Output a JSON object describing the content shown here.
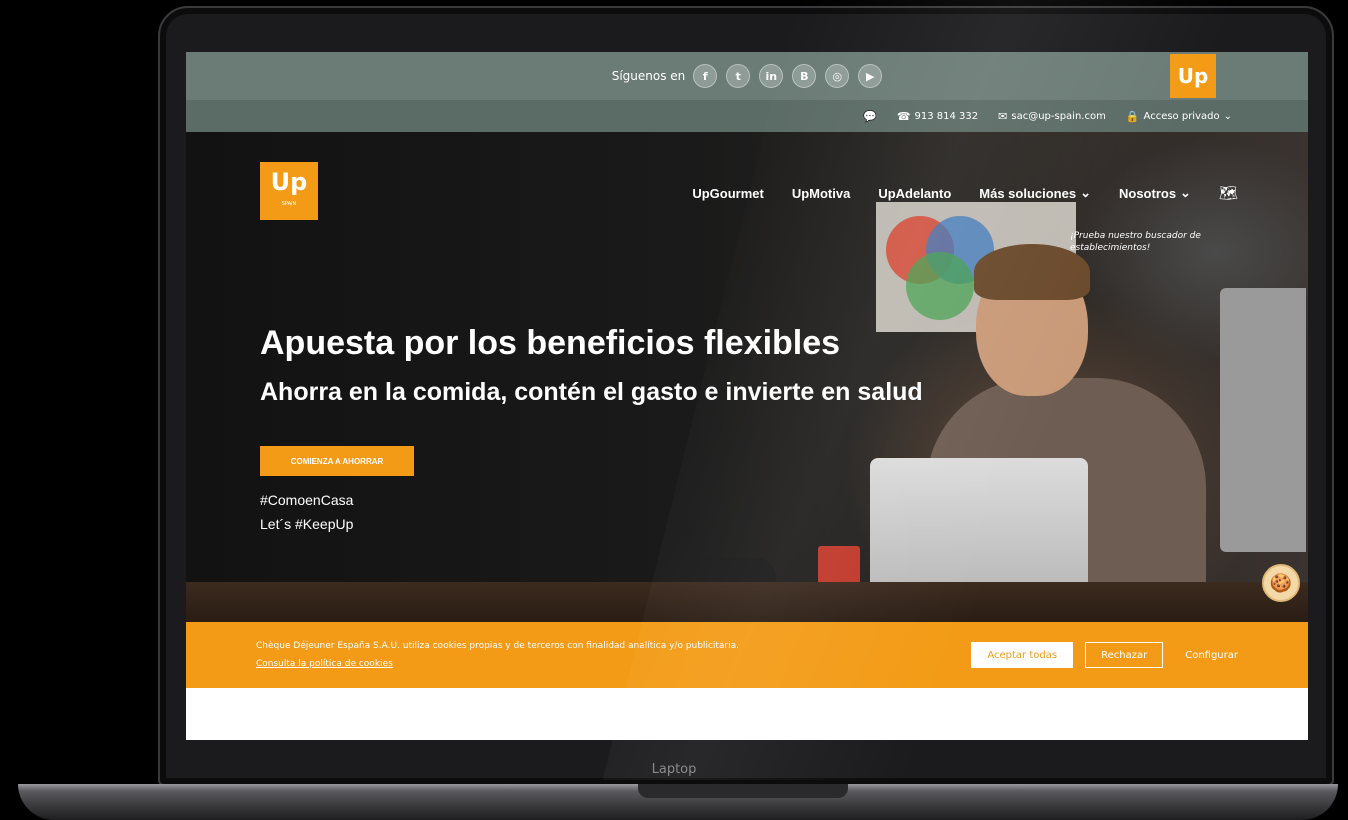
{
  "device": {
    "label": "Laptop"
  },
  "topbar": {
    "follow_label": "Síguenos en",
    "social": [
      {
        "icon": "facebook-icon",
        "glyph": "f"
      },
      {
        "icon": "twitter-icon",
        "glyph": "t"
      },
      {
        "icon": "linkedin-icon",
        "glyph": "in"
      },
      {
        "icon": "blogger-icon",
        "glyph": "B"
      },
      {
        "icon": "instagram-icon",
        "glyph": "◎"
      },
      {
        "icon": "youtube-icon",
        "glyph": "▶"
      }
    ],
    "logo": "Up"
  },
  "contact": {
    "phone": "913 814 332",
    "email": "sac@up-spain.com",
    "private_access": "Acceso privado"
  },
  "header": {
    "logo": "Up",
    "logo_sub": "SPAIN",
    "nav": [
      {
        "label": "UpGourmet"
      },
      {
        "label": "UpMotiva"
      },
      {
        "label": "UpAdelanto"
      },
      {
        "label": "Más soluciones"
      },
      {
        "label": "Nosotros"
      }
    ],
    "search_hint": "¡Prueba nuestro buscador de establecimientos!"
  },
  "hero": {
    "title": "Apuesta por los beneficios flexibles",
    "subtitle": "Ahorra en la comida, contén el gasto e invierte en salud",
    "cta": "COMIENZA A AHORRAR",
    "hashtag1": "#ComoenCasa",
    "hashtag2": "Let´s #KeepUp"
  },
  "cookies": {
    "text": "Chèque Déjeuner España S.A.U. utiliza cookies propias y de terceros con finalidad analítica y/o publicitaria.",
    "link": "Consulta la política de cookies",
    "accept": "Aceptar todas",
    "reject": "Rechazar",
    "configure": "Configurar"
  },
  "colors": {
    "brand_orange": "#f39b16",
    "topbar": "#6b7b75"
  }
}
